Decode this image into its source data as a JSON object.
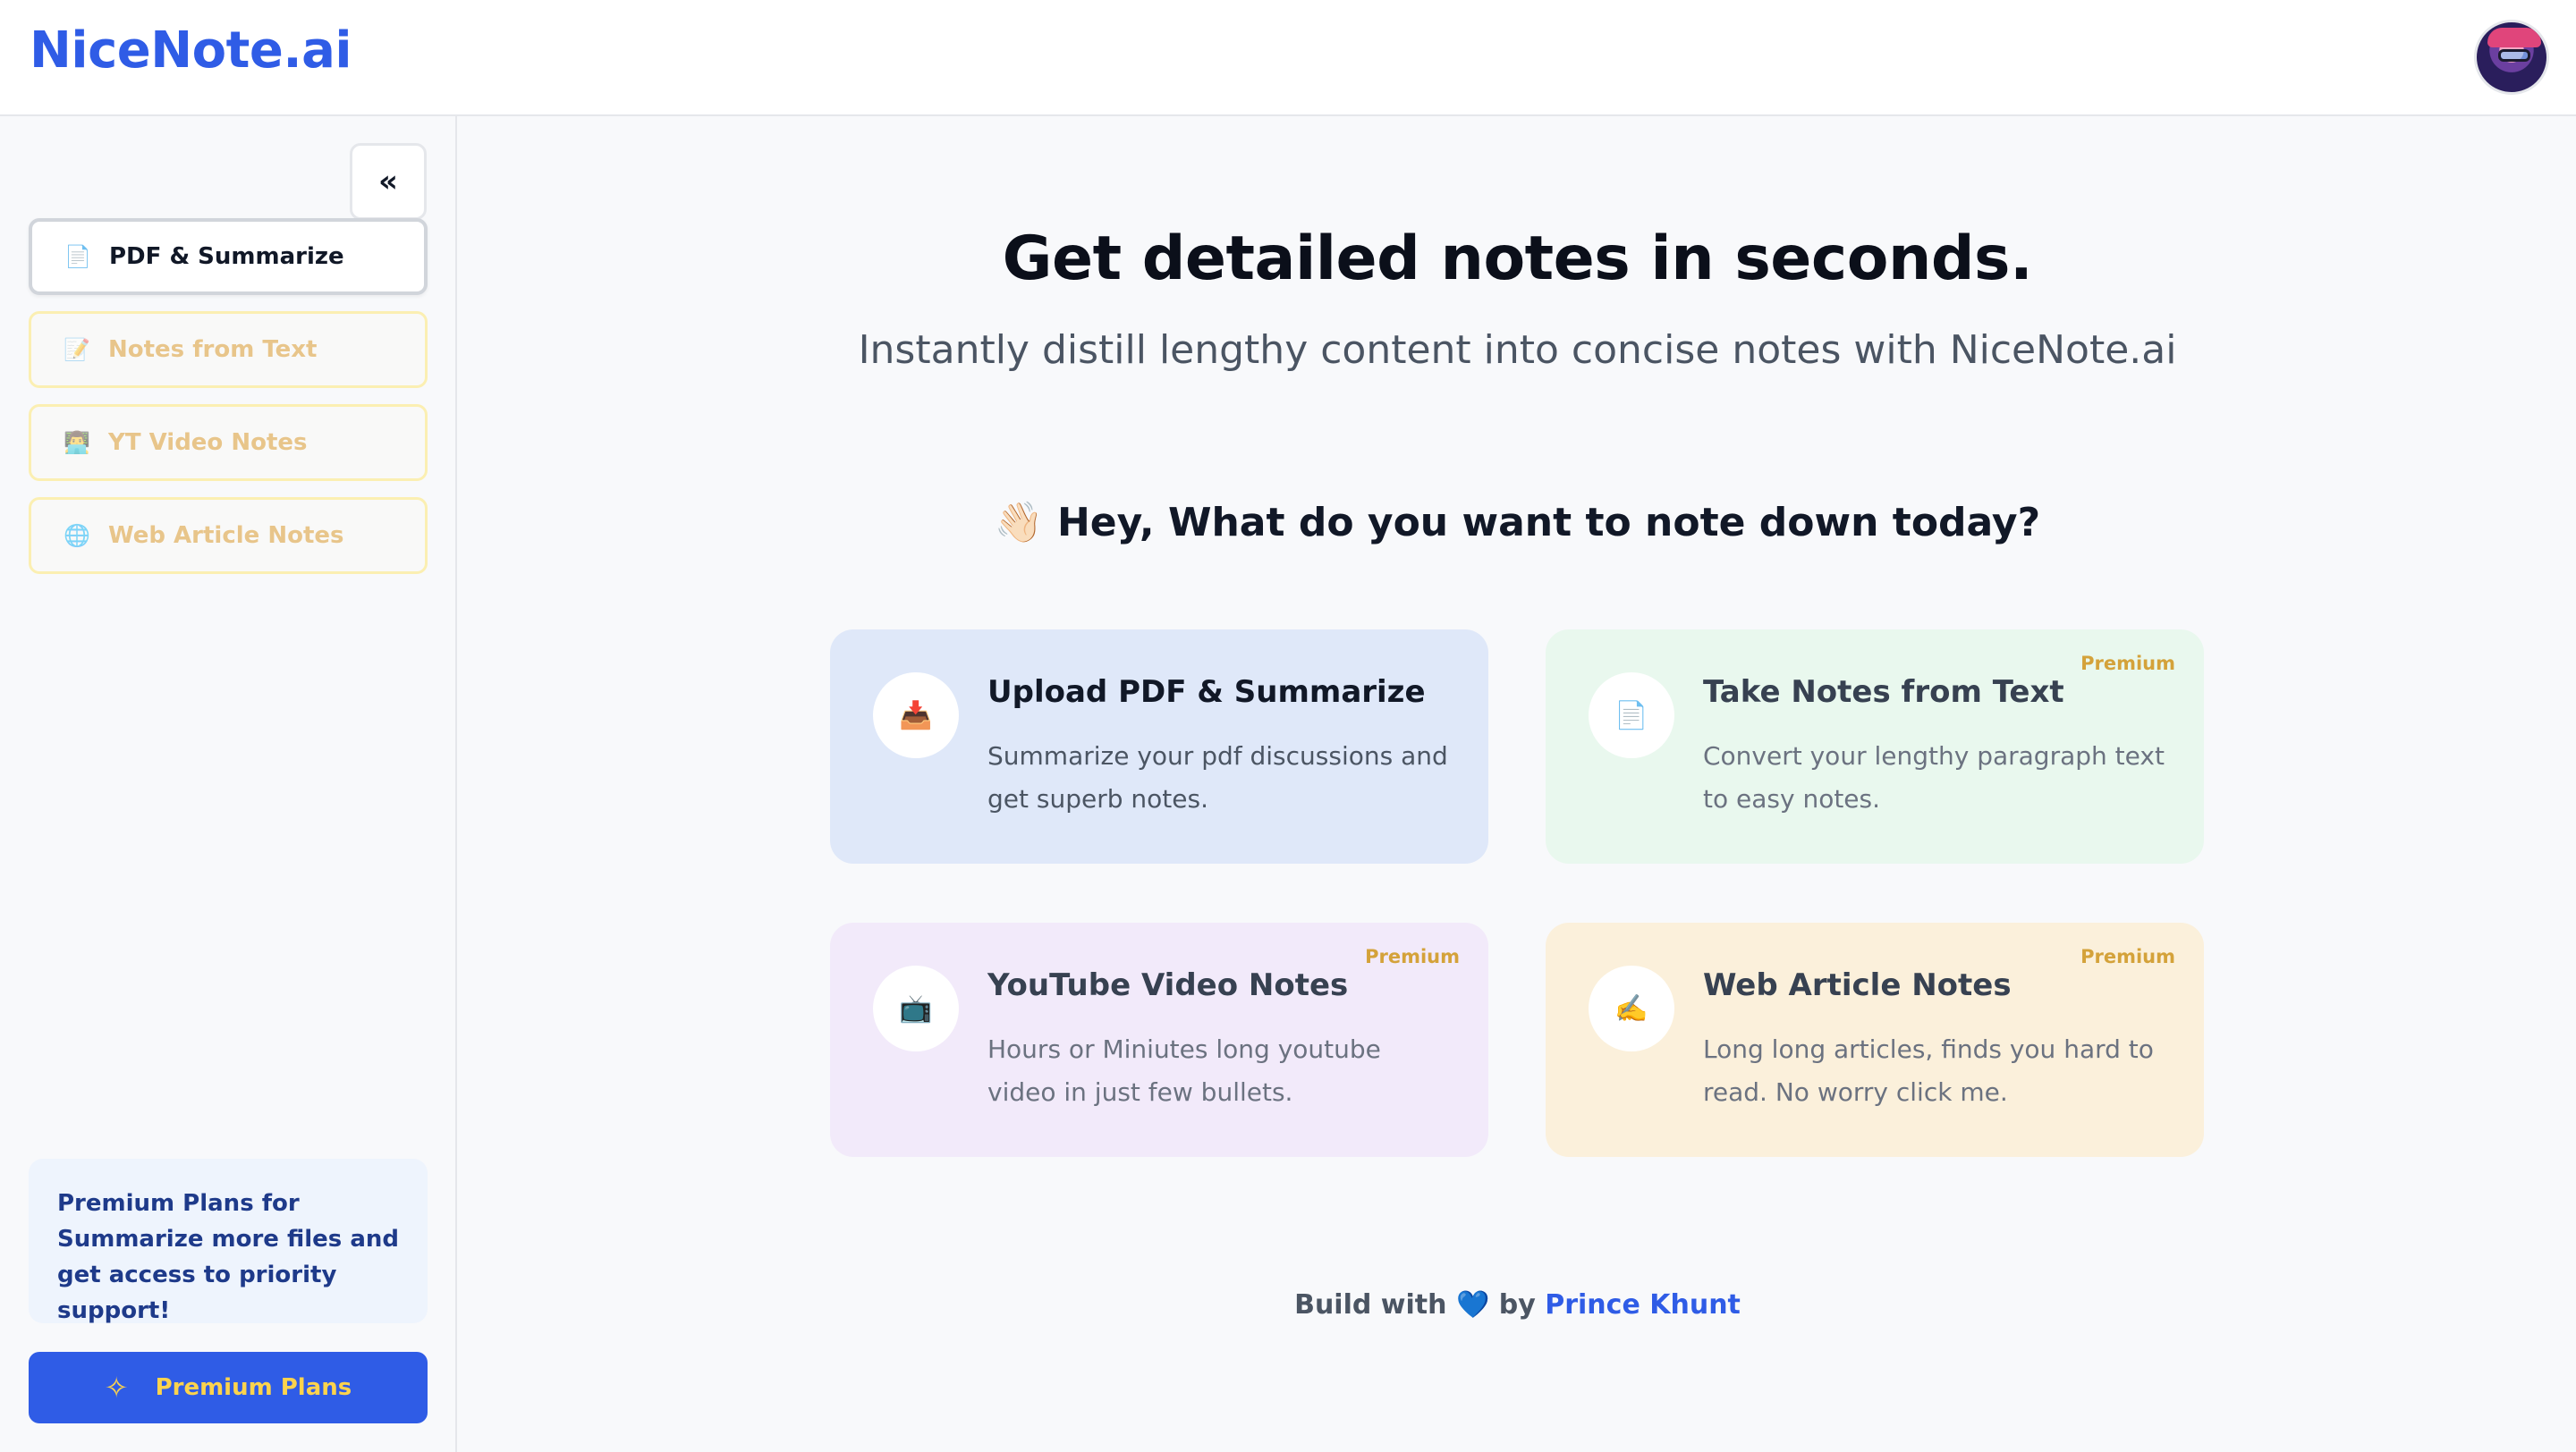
{
  "brand": {
    "name": "NiceNote.ai"
  },
  "header": {
    "avatar_icon": "user-avatar"
  },
  "sidebar": {
    "collapse_icon": "«",
    "items": [
      {
        "label": "PDF & Summarize",
        "icon": "📄",
        "state": "active"
      },
      {
        "label": "Notes from Text",
        "icon": "📝",
        "state": "locked"
      },
      {
        "label": "YT Video Notes",
        "icon": "👨‍💻",
        "state": "locked"
      },
      {
        "label": "Web Article Notes",
        "icon": "🌐",
        "state": "locked"
      }
    ],
    "promo_text": "Premium Plans for Summarize more files and get access to priority support!",
    "premium_button_label": "Premium Plans",
    "premium_button_icon": "✧"
  },
  "main": {
    "headline": "Get detailed notes in seconds.",
    "subheadline": "Instantly distill lengthy content into concise notes with NiceNote.ai",
    "greeting": "👋🏻 Hey, What do you want to note down today?",
    "cards": [
      {
        "title": "Upload PDF & Summarize",
        "desc": "Summarize your pdf discussions and get superb notes.",
        "icon": "📥",
        "badge": ""
      },
      {
        "title": "Take Notes from Text",
        "desc": "Convert your lengthy paragraph text to easy notes.",
        "icon": "📄",
        "badge": "Premium"
      },
      {
        "title": "YouTube Video Notes",
        "desc": "Hours or Miniutes long youtube video in just few bullets.",
        "icon": "📺",
        "badge": "Premium"
      },
      {
        "title": "Web Article Notes",
        "desc": "Long long articles, finds you hard to read. No worry click me.",
        "icon": "✍️",
        "badge": "Premium"
      }
    ]
  },
  "footer": {
    "prefix": "Build with",
    "heart": "💙",
    "by": "by",
    "author": "Prince Khunt"
  },
  "colors": {
    "brand": "#2f5ce6",
    "premium_badge": "#d4a23a",
    "card_pdf": "#dfe8f9",
    "card_text": "#e9f8ee",
    "card_yt": "#f2eafa",
    "card_web": "#fbf0db"
  }
}
